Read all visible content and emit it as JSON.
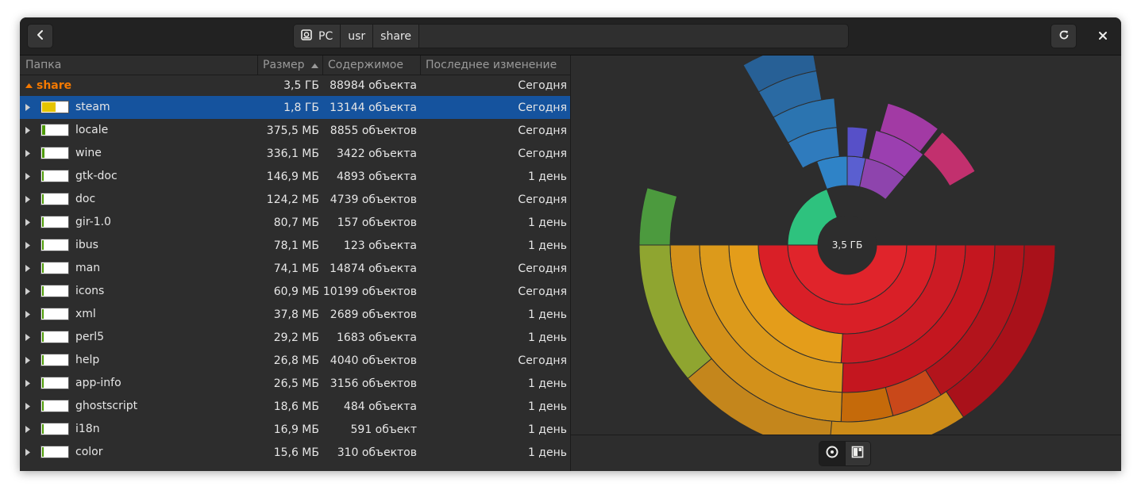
{
  "header": {
    "back_icon": "go-previous-icon",
    "path": [
      {
        "label": "PC",
        "icon": "drive-icon"
      },
      {
        "label": "usr"
      },
      {
        "label": "share"
      }
    ],
    "refresh_icon": "view-refresh-icon",
    "close_icon": "window-close-icon"
  },
  "columns": {
    "folder": "Папка",
    "size": "Размер",
    "contents": "Содержимое",
    "modified": "Последнее изменение"
  },
  "parent_row": {
    "name": "share",
    "size": "3,5 ГБ",
    "contents": "88984 объекта",
    "modified": "Сегодня"
  },
  "rows": [
    {
      "name": "steam",
      "size": "1,8 ГБ",
      "contents": "13144 объекта",
      "modified": "Сегодня",
      "fraction": 0.51,
      "fill": "#e5c400"
    },
    {
      "name": "locale",
      "size": "375,5 МБ",
      "contents": "8855 объектов",
      "modified": "Сегодня",
      "fraction": 0.107,
      "fill": "#4e9a06"
    },
    {
      "name": "wine",
      "size": "336,1 МБ",
      "contents": "3422 объекта",
      "modified": "Сегодня",
      "fraction": 0.096,
      "fill": "#4e9a06"
    },
    {
      "name": "gtk-doc",
      "size": "146,9 МБ",
      "contents": "4893 объекта",
      "modified": "1 день",
      "fraction": 0.042,
      "fill": "#4e9a06"
    },
    {
      "name": "doc",
      "size": "124,2 МБ",
      "contents": "4739 объектов",
      "modified": "Сегодня",
      "fraction": 0.035,
      "fill": "#4e9a06"
    },
    {
      "name": "gir-1.0",
      "size": "80,7 МБ",
      "contents": "157 объектов",
      "modified": "1 день",
      "fraction": 0.023,
      "fill": "#4e9a06"
    },
    {
      "name": "ibus",
      "size": "78,1 МБ",
      "contents": "123 объекта",
      "modified": "1 день",
      "fraction": 0.022,
      "fill": "#4e9a06"
    },
    {
      "name": "man",
      "size": "74,1 МБ",
      "contents": "14874 объекта",
      "modified": "Сегодня",
      "fraction": 0.021,
      "fill": "#4e9a06"
    },
    {
      "name": "icons",
      "size": "60,9 МБ",
      "contents": "10199 объектов",
      "modified": "Сегодня",
      "fraction": 0.017,
      "fill": "#4e9a06"
    },
    {
      "name": "xml",
      "size": "37,8 МБ",
      "contents": "2689 объектов",
      "modified": "1 день",
      "fraction": 0.011,
      "fill": "#4e9a06"
    },
    {
      "name": "perl5",
      "size": "29,2 МБ",
      "contents": "1683 объекта",
      "modified": "1 день",
      "fraction": 0.008,
      "fill": "#4e9a06"
    },
    {
      "name": "help",
      "size": "26,8 МБ",
      "contents": "4040 объектов",
      "modified": "Сегодня",
      "fraction": 0.008,
      "fill": "#4e9a06"
    },
    {
      "name": "app-info",
      "size": "26,5 МБ",
      "contents": "3156 объектов",
      "modified": "1 день",
      "fraction": 0.008,
      "fill": "#4e9a06"
    },
    {
      "name": "ghostscript",
      "size": "18,6 МБ",
      "contents": "484 объекта",
      "modified": "1 день",
      "fraction": 0.005,
      "fill": "#4e9a06"
    },
    {
      "name": "i18n",
      "size": "16,9 МБ",
      "contents": "591 объект",
      "modified": "1 день",
      "fraction": 0.005,
      "fill": "#4e9a06"
    },
    {
      "name": "color",
      "size": "15,6 МБ",
      "contents": "310 объектов",
      "modified": "1 день",
      "fraction": 0.004,
      "fill": "#4e9a06"
    }
  ],
  "chart": {
    "center_label": "3,5 ГБ"
  },
  "view_switch": {
    "rings_icon": "rings-chart-icon",
    "treemap_icon": "treemap-chart-icon"
  }
}
